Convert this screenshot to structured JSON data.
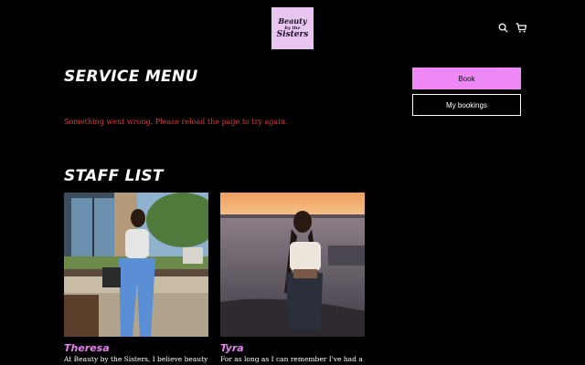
{
  "header": {
    "logo_line1": "Beauty",
    "logo_line2": "by the",
    "logo_line3": "Sisters",
    "icons": [
      "search-icon",
      "cart-icon"
    ]
  },
  "service_menu": {
    "title": "SERVICE MENU",
    "error_text": "Something went wrong. Please reload the page to try again."
  },
  "actions": {
    "book_label": "Book",
    "my_bookings_label": "My bookings"
  },
  "staff_list": {
    "title": "STAFF LIST",
    "members": [
      {
        "name": "Theresa",
        "bio": "At Beauty by the Sisters, I believe beauty"
      },
      {
        "name": "Tyra",
        "bio": "For as long as I can remember I've had a"
      }
    ]
  },
  "colors": {
    "background": "#000000",
    "accent_pink": "#ee88f6",
    "name_pink": "#e680f0",
    "error_red": "#d53b3b",
    "logo_bg": "#e9c6f2"
  }
}
